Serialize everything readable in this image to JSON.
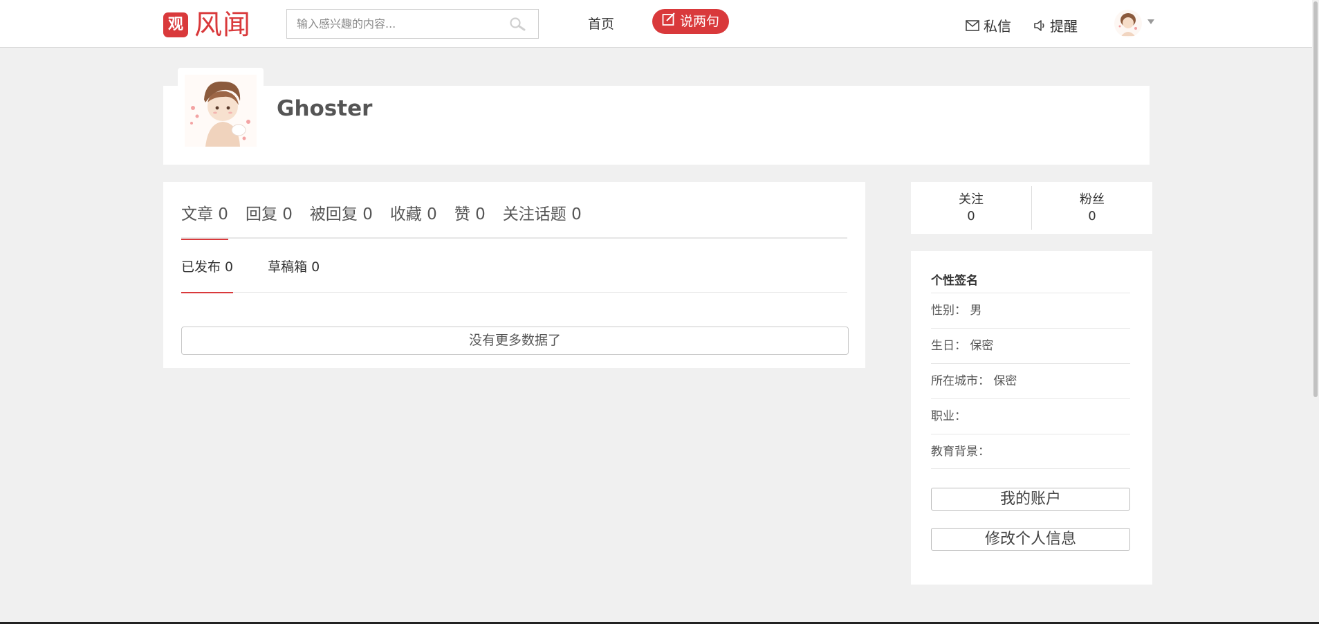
{
  "header": {
    "logo_mark": "观",
    "logo_text": "风闻",
    "search_placeholder": "输入感兴趣的内容...",
    "nav_home": "首页",
    "post_button": "说两句",
    "messages": "私信",
    "reminders": "提醒"
  },
  "profile": {
    "username": "Ghoster"
  },
  "tabs": [
    {
      "label": "文章 0"
    },
    {
      "label": "回复 0"
    },
    {
      "label": "被回复 0"
    },
    {
      "label": "收藏 0"
    },
    {
      "label": "赞 0"
    },
    {
      "label": "关注话题 0"
    }
  ],
  "subtabs": [
    {
      "label": "已发布 0"
    },
    {
      "label": "草稿箱 0"
    }
  ],
  "no_more_text": "没有更多数据了",
  "stats": {
    "following_label": "关注",
    "following_value": "0",
    "followers_label": "粉丝",
    "followers_value": "0"
  },
  "info": {
    "title": "个性签名",
    "rows": [
      {
        "text": "性别：  男"
      },
      {
        "text": "生日：  保密"
      },
      {
        "text": "所在城市：  保密"
      },
      {
        "text": "职业："
      },
      {
        "text": "教育背景："
      }
    ],
    "my_account": "我的账户",
    "edit_profile": "修改个人信息"
  },
  "colors": {
    "accent": "#d9393b",
    "background": "#f0f0f0"
  }
}
